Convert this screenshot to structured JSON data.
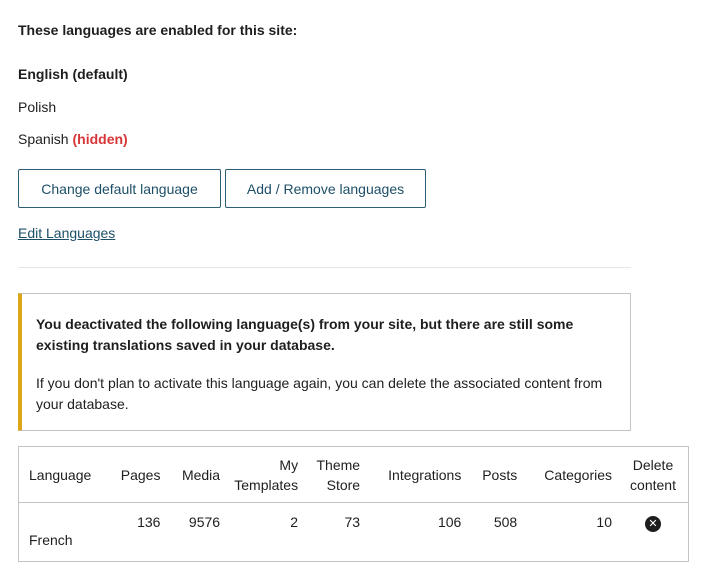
{
  "languages_section": {
    "heading": "These languages are enabled for this site:",
    "languages": [
      {
        "name": "English (default)"
      },
      {
        "name": "Polish"
      },
      {
        "name": "Spanish",
        "tag": "(hidden)"
      }
    ],
    "change_default_label": "Change default language",
    "add_remove_label": "Add / Remove languages",
    "edit_link_label": "Edit Languages"
  },
  "notice": {
    "strong_text": "You deactivated the following language(s) from your site, but there are still some existing translations saved in your database.",
    "body_text": "If you don't plan to activate this language again, you can delete the associated content from your database.",
    "accent_color": "#dba617"
  },
  "table": {
    "headers": {
      "language": "Language",
      "pages": "Pages",
      "media": "Media",
      "my_templates": "My Templates",
      "theme_store": "Theme Store",
      "integrations": "Integrations",
      "posts": "Posts",
      "categories": "Categories",
      "delete_content": "Delete content"
    },
    "rows": [
      {
        "language": "French",
        "pages": "136",
        "media": "9576",
        "my_templates": "2",
        "theme_store": "73",
        "integrations": "106",
        "posts": "508",
        "categories": "10",
        "delete_icon": "close-circle-icon"
      }
    ]
  },
  "colors": {
    "link": "#1d4f68",
    "hidden_tag": "#d63638"
  }
}
